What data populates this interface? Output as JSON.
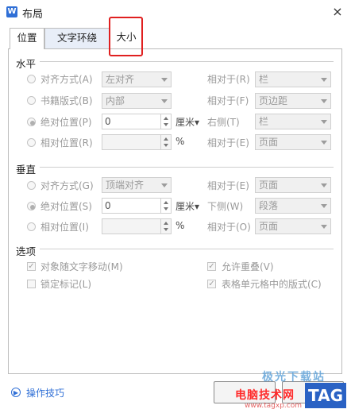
{
  "window": {
    "title": "布局",
    "app_icon_letter": "W",
    "close": "×"
  },
  "tabs": [
    {
      "label": "位置",
      "active": true
    },
    {
      "label": "文字环绕",
      "active": false
    },
    {
      "label": "大小",
      "active": false
    }
  ],
  "horizontal": {
    "title": "水平",
    "alignment": {
      "label": "对齐方式(A)",
      "value": "左对齐",
      "relative_label": "相对于(R)",
      "relative_value": "栏"
    },
    "book_layout": {
      "label": "书籍版式(B)",
      "value": "内部",
      "relative_label": "相对于(F)",
      "relative_value": "页边距"
    },
    "absolute": {
      "label": "绝对位置(P)",
      "value": "0",
      "unit": "厘米",
      "relative_label": "右侧(T)",
      "relative_value": "栏"
    },
    "relative": {
      "label": "相对位置(R)",
      "value": "",
      "unit": "%",
      "relative_label": "相对于(E)",
      "relative_value": "页面"
    }
  },
  "vertical": {
    "title": "垂直",
    "alignment": {
      "label": "对齐方式(G)",
      "value": "顶端对齐",
      "relative_label": "相对于(E)",
      "relative_value": "页面"
    },
    "absolute": {
      "label": "绝对位置(S)",
      "value": "0",
      "unit": "厘米",
      "relative_label": "下侧(W)",
      "relative_value": "段落"
    },
    "relative": {
      "label": "相对位置(I)",
      "value": "",
      "unit": "%",
      "relative_label": "相对于(O)",
      "relative_value": "页面"
    }
  },
  "options": {
    "title": "选项",
    "move_with_text": {
      "label": "对象随文字移动(M)",
      "checked": true
    },
    "allow_overlap": {
      "label": "允许重叠(V)",
      "checked": true
    },
    "lock_anchor": {
      "label": "锁定标记(L)",
      "checked": false
    },
    "table_cell_layout": {
      "label": "表格单元格中的版式(C)",
      "checked": true
    }
  },
  "footer": {
    "help_label": "操作技巧"
  },
  "watermark": {
    "brand": "电脑技术网",
    "url": "www.tagxp.com",
    "tag": "TAG",
    "top_text": "极光下载站"
  }
}
